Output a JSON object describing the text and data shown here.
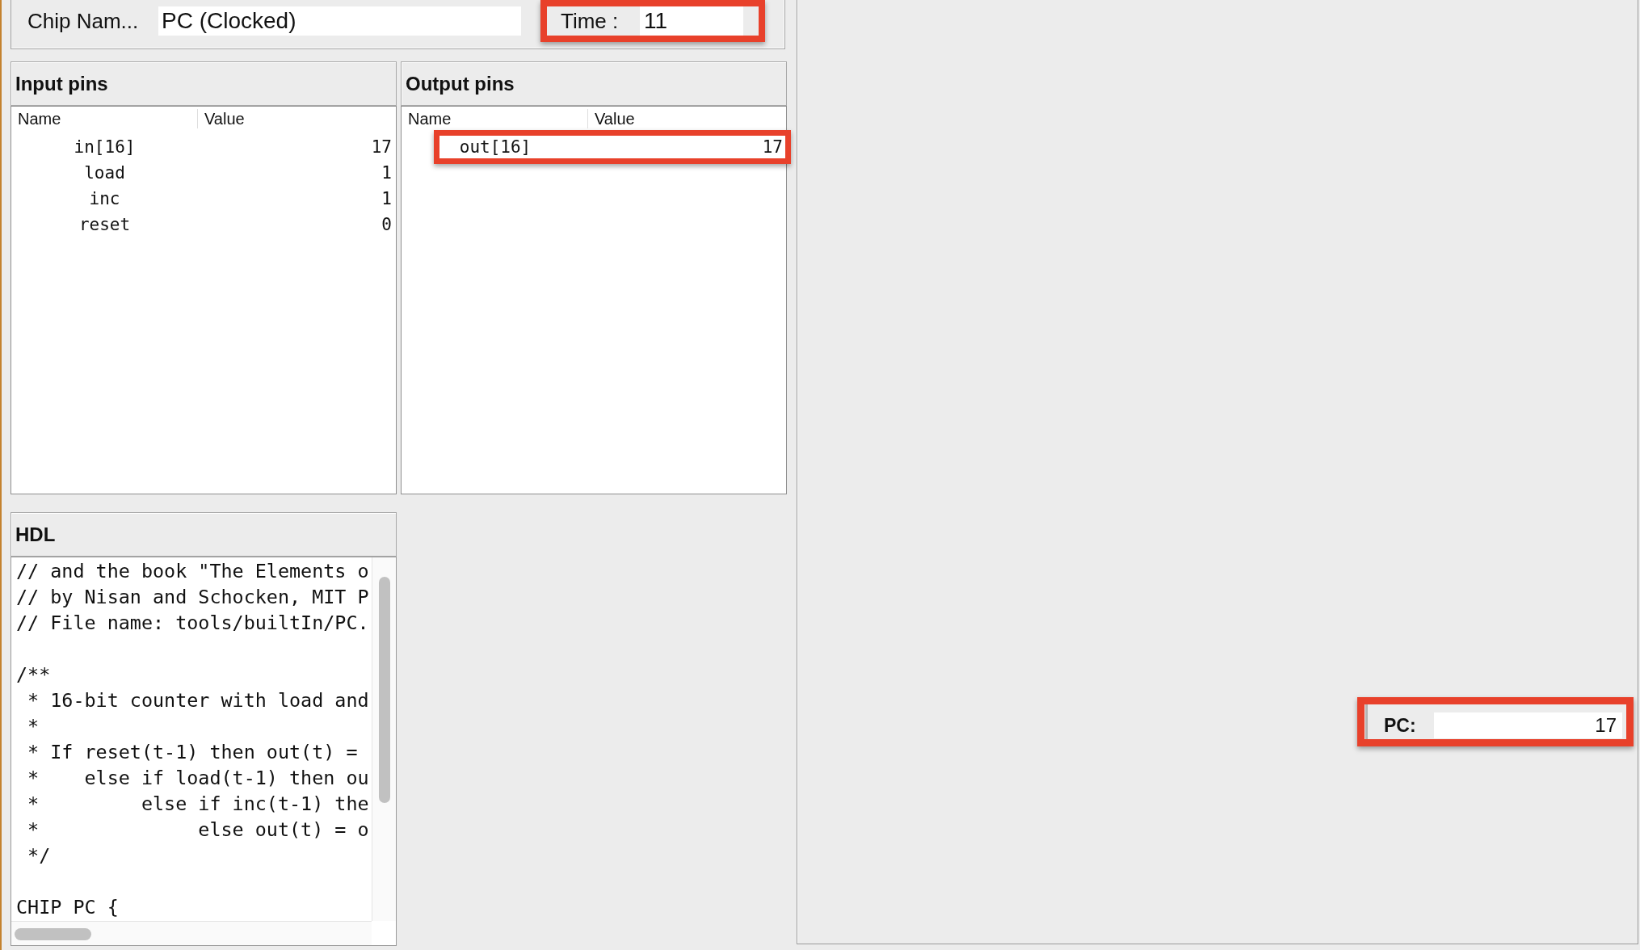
{
  "chip_bar": {
    "label": "Chip Nam...",
    "chip_name": "PC (Clocked)",
    "time": {
      "label": "Time :",
      "value": "11",
      "highlighted": true
    }
  },
  "input_pins": {
    "title": "Input pins",
    "columns": [
      "Name",
      "Value"
    ],
    "rows": [
      {
        "name": "in[16]",
        "value": "17",
        "highlighted": false
      },
      {
        "name": "load",
        "value": "1",
        "highlighted": false
      },
      {
        "name": "inc",
        "value": "1",
        "highlighted": false
      },
      {
        "name": "reset",
        "value": "0",
        "highlighted": false
      }
    ]
  },
  "output_pins": {
    "title": "Output pins",
    "columns": [
      "Name",
      "Value"
    ],
    "rows": [
      {
        "name": "out[16]",
        "value": "17",
        "highlighted": true
      }
    ]
  },
  "hdl": {
    "title": "HDL",
    "code": "// and the book \"The Elements o\n// by Nisan and Schocken, MIT P\n// File name: tools/builtIn/PC.\n\n/**\n * 16-bit counter with load and\n *\n * If reset(t-1) then out(t) =\n *    else if load(t-1) then ou\n *         else if inc(t-1) the\n *              else out(t) = o\n */\n\nCHIP PC {"
  },
  "chip_gui": {
    "register": {
      "label": "PC:",
      "value": "17",
      "highlighted": true
    }
  }
}
